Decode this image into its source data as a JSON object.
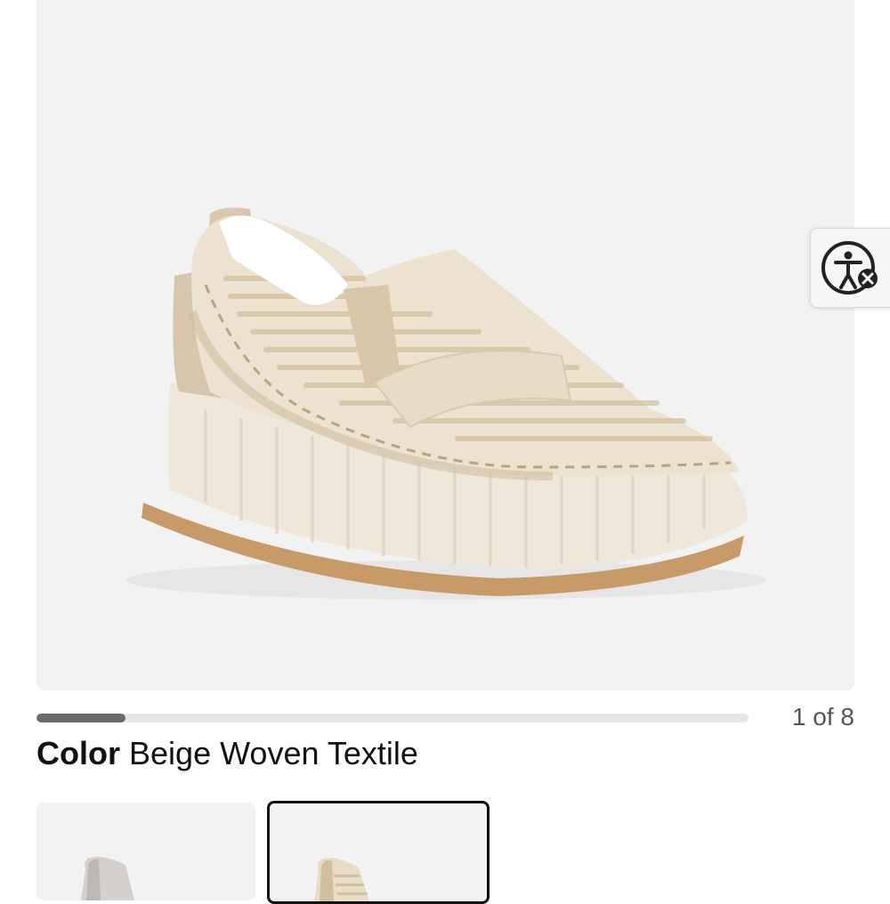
{
  "gallery": {
    "counter": "1 of 8",
    "progress_fraction": 0.125
  },
  "product": {
    "color_label": "Color",
    "color_value": "Beige Woven Textile"
  },
  "accessibility": {
    "icon": "accessibility-icon"
  },
  "swatches": [
    {
      "icon": "shoe-thumbnail-grey",
      "selected": false
    },
    {
      "icon": "shoe-thumbnail-beige",
      "selected": true
    }
  ]
}
